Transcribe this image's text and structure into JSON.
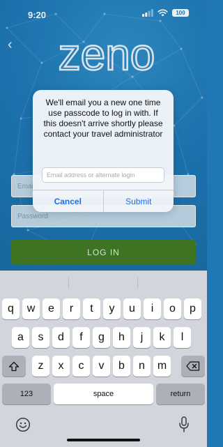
{
  "status_bar": {
    "time": "9:20",
    "battery": "100"
  },
  "app": {
    "logo_text": "zeno",
    "email_field": {
      "placeholder": "Email"
    },
    "password_field": {
      "placeholder": "Password"
    },
    "login_button": "LOG IN"
  },
  "dialog": {
    "message": "We'll email you a new one time use passcode to log in with. If this doesn't arrive shortly please contact your travel administrator",
    "input": {
      "placeholder": "Email address or alternate login",
      "value": ""
    },
    "cancel_label": "Cancel",
    "submit_label": "Submit"
  },
  "keyboard": {
    "row1": [
      "q",
      "w",
      "e",
      "r",
      "t",
      "y",
      "u",
      "i",
      "o",
      "p"
    ],
    "row2": [
      "a",
      "s",
      "d",
      "f",
      "g",
      "h",
      "j",
      "k",
      "l"
    ],
    "row3": [
      "z",
      "x",
      "c",
      "v",
      "b",
      "n",
      "m"
    ],
    "numbers_label": "123",
    "space_label": "space",
    "return_label": "return"
  },
  "colors": {
    "brand_blue": "#1f79b7",
    "login_green": "#417b25",
    "ios_link_blue": "#1a73e8"
  }
}
